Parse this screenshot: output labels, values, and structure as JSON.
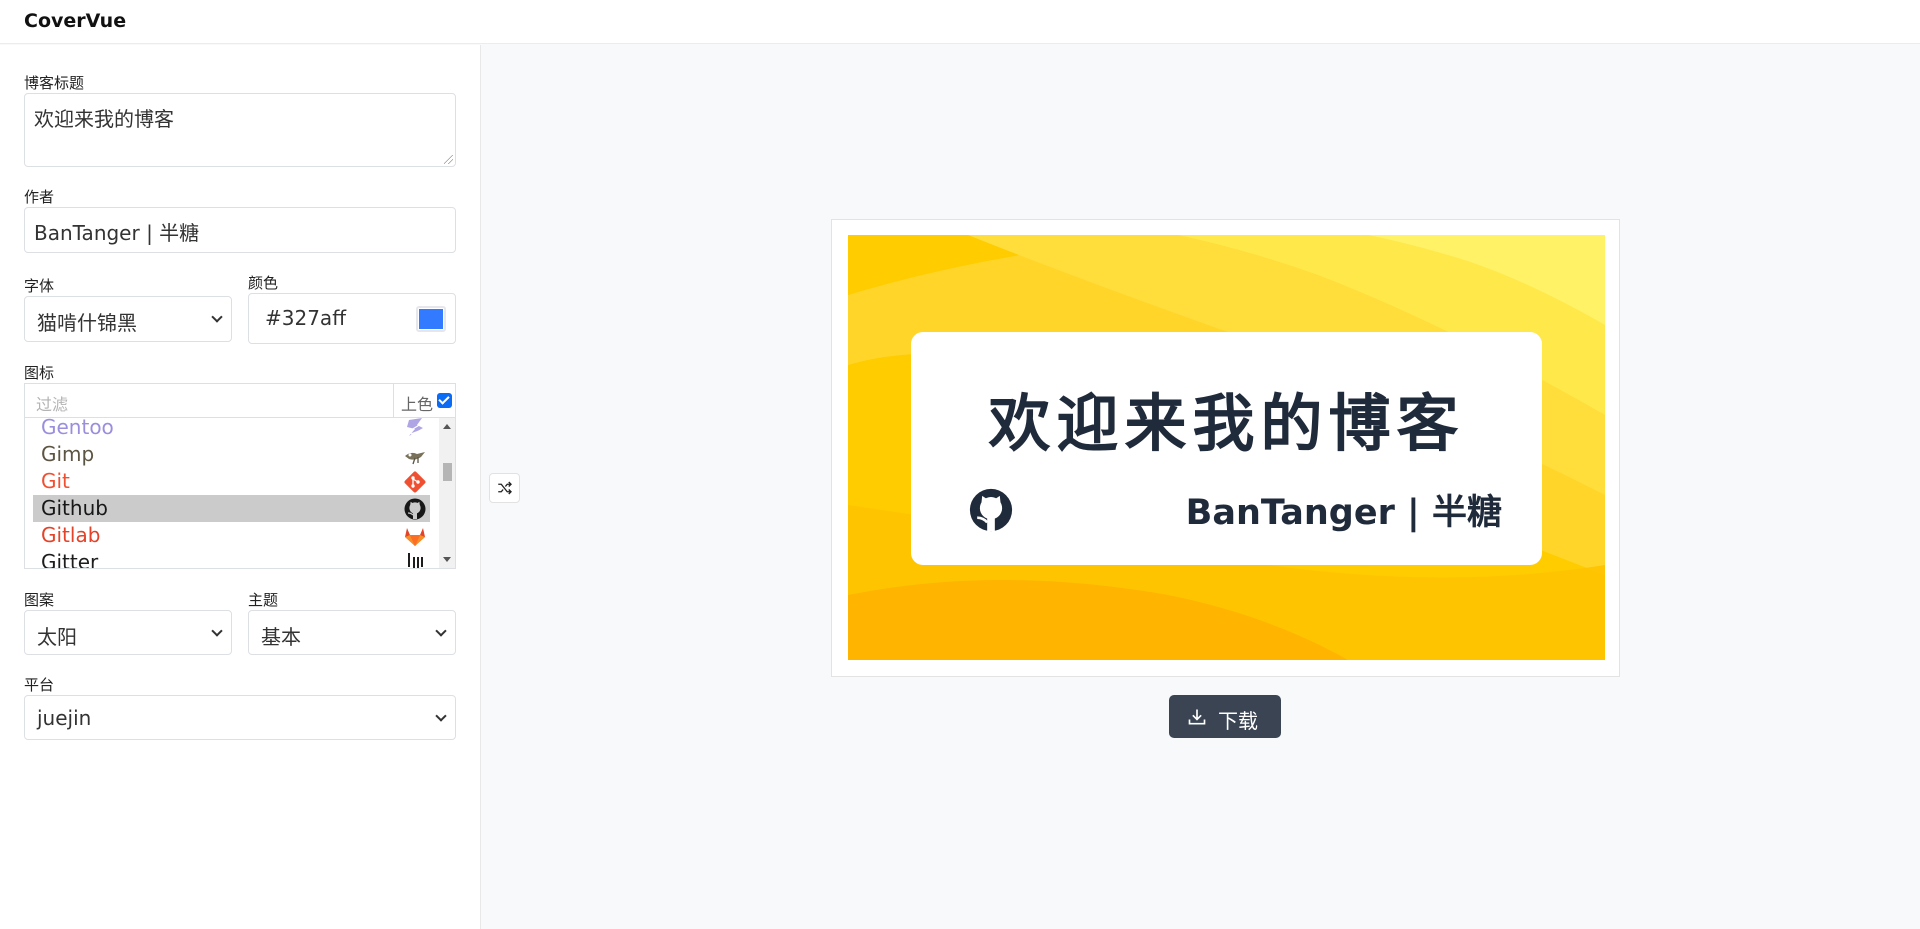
{
  "app": {
    "title": "CoverVue"
  },
  "form": {
    "title_label": "博客标题",
    "title_value": "欢迎来我的博客",
    "author_label": "作者",
    "author_value": "BanTanger | 半糖",
    "font_label": "字体",
    "font_value": "猫啃什锦黑",
    "color_label": "颜色",
    "color_value": "#327aff",
    "icon_label": "图标",
    "filter_placeholder": "过滤",
    "colorize_label": "上色",
    "colorize_checked": true,
    "pattern_label": "图案",
    "pattern_value": "太阳",
    "theme_label": "主题",
    "theme_value": "基本",
    "platform_label": "平台",
    "platform_value": "juejin"
  },
  "icon_list": [
    {
      "name": "Gentoo",
      "icon": "gentoo-icon",
      "color": "#9b8fdd"
    },
    {
      "name": "Gimp",
      "icon": "gimp-icon",
      "color": "#5c5543"
    },
    {
      "name": "Git",
      "icon": "git-icon",
      "color": "#f05032"
    },
    {
      "name": "Github",
      "icon": "github-icon",
      "color": "#181717",
      "selected": true
    },
    {
      "name": "Gitlab",
      "icon": "gitlab-icon",
      "color": "#e24329"
    },
    {
      "name": "Gitter",
      "icon": "gitter-icon",
      "color": "#1d1d1d"
    }
  ],
  "preview": {
    "title": "欢迎来我的博客",
    "author": "BanTanger | 半糖",
    "icon": "github-icon",
    "text_color": "#1f2a3a"
  },
  "actions": {
    "shuffle_icon": "shuffle-icon",
    "download_label": "下载",
    "download_icon": "download-icon"
  }
}
